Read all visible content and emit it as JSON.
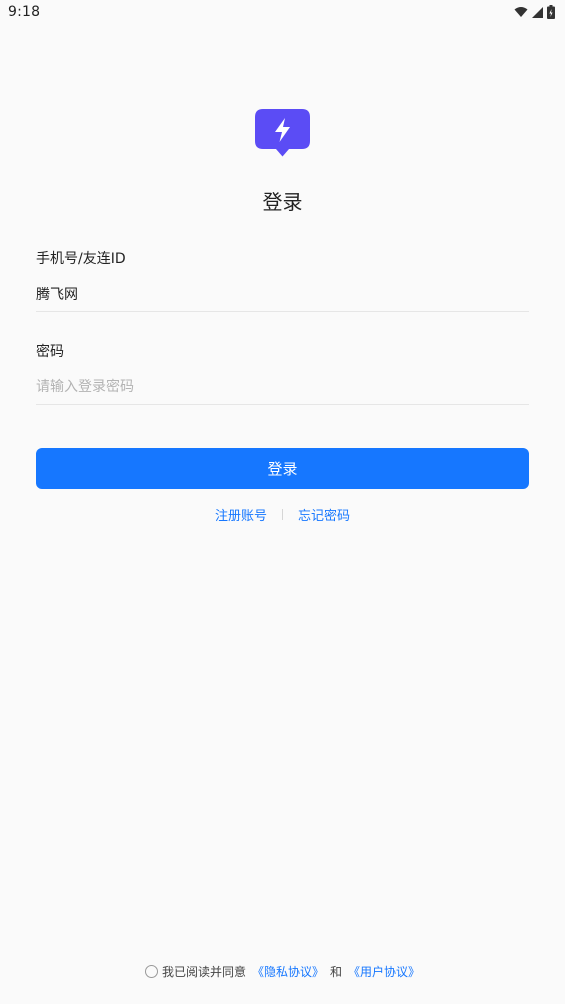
{
  "status_bar": {
    "time": "9:18"
  },
  "login": {
    "title": "登录",
    "phone_label": "手机号/友连ID",
    "phone_value": "腾飞网",
    "password_label": "密码",
    "password_placeholder": "请输入登录密码",
    "login_button": "登录",
    "register_link": "注册账号",
    "forgot_link": "忘记密码"
  },
  "agreement": {
    "text": "我已阅读并同意",
    "privacy_link": "《隐私协议》",
    "and": "和",
    "user_link": "《用户协议》"
  },
  "colors": {
    "accent": "#1677ff",
    "logo": "#5b4cf5"
  }
}
